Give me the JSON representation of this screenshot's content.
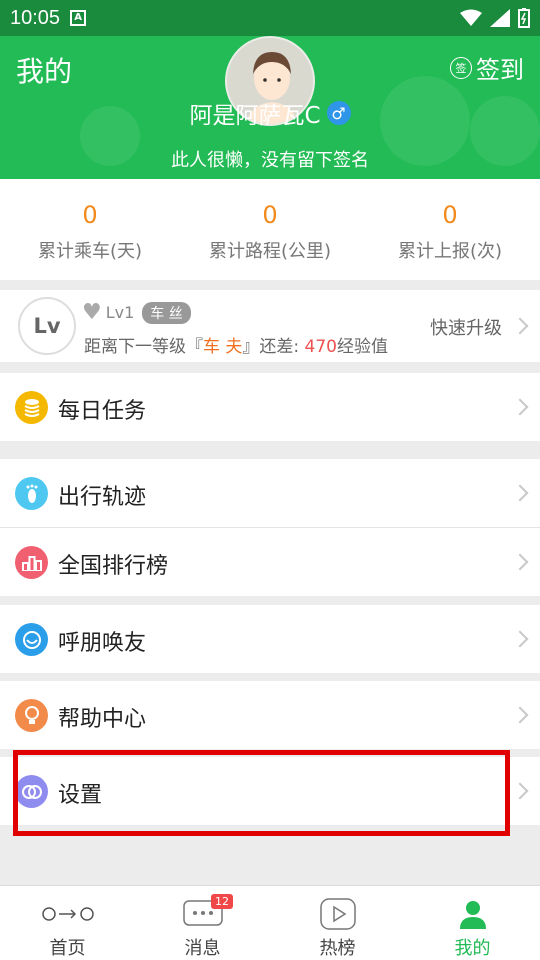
{
  "status_bar": {
    "time": "10:05"
  },
  "header": {
    "title": "我的",
    "checkin_badge": "签",
    "checkin_label": "签到",
    "username": "阿是阿萨瓦C",
    "gender_symbol": "♂",
    "signature": "此人很懒，没有留下签名"
  },
  "stats": [
    {
      "value": "0",
      "label": "累计乘车(天)"
    },
    {
      "value": "0",
      "label": "累计路程(公里)"
    },
    {
      "value": "0",
      "label": "累计上报(次)"
    }
  ],
  "level": {
    "circle_text": "Lv",
    "level_text": "Lv1",
    "title_tag": "车 丝",
    "next_prefix": "距离下一等级『",
    "next_level": "车 夫",
    "next_mid": "』还差: ",
    "exp_needed": "470",
    "next_suffix": "经验值",
    "upgrade_label": "快速升级"
  },
  "menu": {
    "daily_tasks": {
      "label": "每日任务",
      "icon": "coin-stack-icon",
      "color": "#f5b800"
    },
    "travel_track": {
      "label": "出行轨迹",
      "icon": "footprint-icon",
      "color": "#4ec8f0"
    },
    "leaderboard": {
      "label": "全国排行榜",
      "icon": "podium-icon",
      "color": "#f06070"
    },
    "invite_friends": {
      "label": "呼朋唤友",
      "icon": "smile-icon",
      "color": "#2a9ee8"
    },
    "help_center": {
      "label": "帮助中心",
      "icon": "lightbulb-icon",
      "color": "#f28a4a"
    },
    "settings": {
      "label": "设置",
      "icon": "settings-rings-icon",
      "color": "#8f8cf0"
    }
  },
  "bottom_nav": [
    {
      "label": "首页",
      "icon": "route-icon"
    },
    {
      "label": "消息",
      "icon": "chat-icon",
      "badge": "12"
    },
    {
      "label": "热榜",
      "icon": "play-icon"
    },
    {
      "label": "我的",
      "icon": "person-icon",
      "active": true
    }
  ],
  "colors": {
    "brand_green": "#22bb55",
    "accent_orange": "#f08a1c",
    "highlight_red": "#e10000"
  }
}
